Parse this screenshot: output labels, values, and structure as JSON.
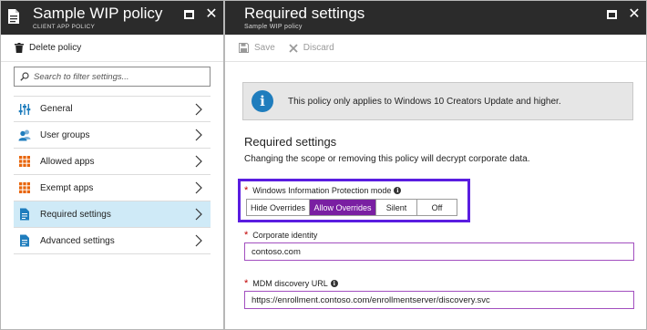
{
  "left_blade": {
    "title": "Sample WIP policy",
    "subtitle": "CLIENT APP POLICY",
    "icons": {
      "header": "document-icon",
      "maximize": "maximize-icon",
      "close": "close-icon"
    },
    "delete_label": "Delete policy",
    "search_placeholder": "Search to filter settings...",
    "nav": [
      {
        "label": "General",
        "icon": "settings-sliders-icon",
        "active": false
      },
      {
        "label": "User groups",
        "icon": "users-icon",
        "active": false
      },
      {
        "label": "Allowed apps",
        "icon": "apps-grid-icon",
        "active": false
      },
      {
        "label": "Exempt apps",
        "icon": "apps-grid-icon",
        "active": false
      },
      {
        "label": "Required settings",
        "icon": "document-icon",
        "active": true
      },
      {
        "label": "Advanced settings",
        "icon": "document-icon",
        "active": false
      }
    ]
  },
  "right_blade": {
    "title": "Required settings",
    "subtitle": "Sample WIP policy",
    "save_label": "Save",
    "discard_label": "Discard",
    "notice": "This policy only applies to Windows 10 Creators Update and higher.",
    "section_title": "Required settings",
    "section_desc": "Changing the scope or removing this policy will decrypt corporate data.",
    "wip_mode": {
      "label": "Windows Information Protection mode",
      "options": [
        "Hide Overrides",
        "Allow Overrides",
        "Silent",
        "Off"
      ],
      "selected": "Allow Overrides"
    },
    "corporate_identity": {
      "label": "Corporate identity",
      "value": "contoso.com"
    },
    "mdm_url": {
      "label": "MDM discovery URL",
      "value": "https://enrollment.contoso.com/enrollmentserver/discovery.svc"
    }
  },
  "colors": {
    "header_bg": "#2b2b2b",
    "active_nav": "#cfeaf7",
    "selected_option": "#7a1fa2",
    "highlight_border": "#5a1de0",
    "required_star": "#c00000",
    "info_blue": "#1f7dbd"
  }
}
